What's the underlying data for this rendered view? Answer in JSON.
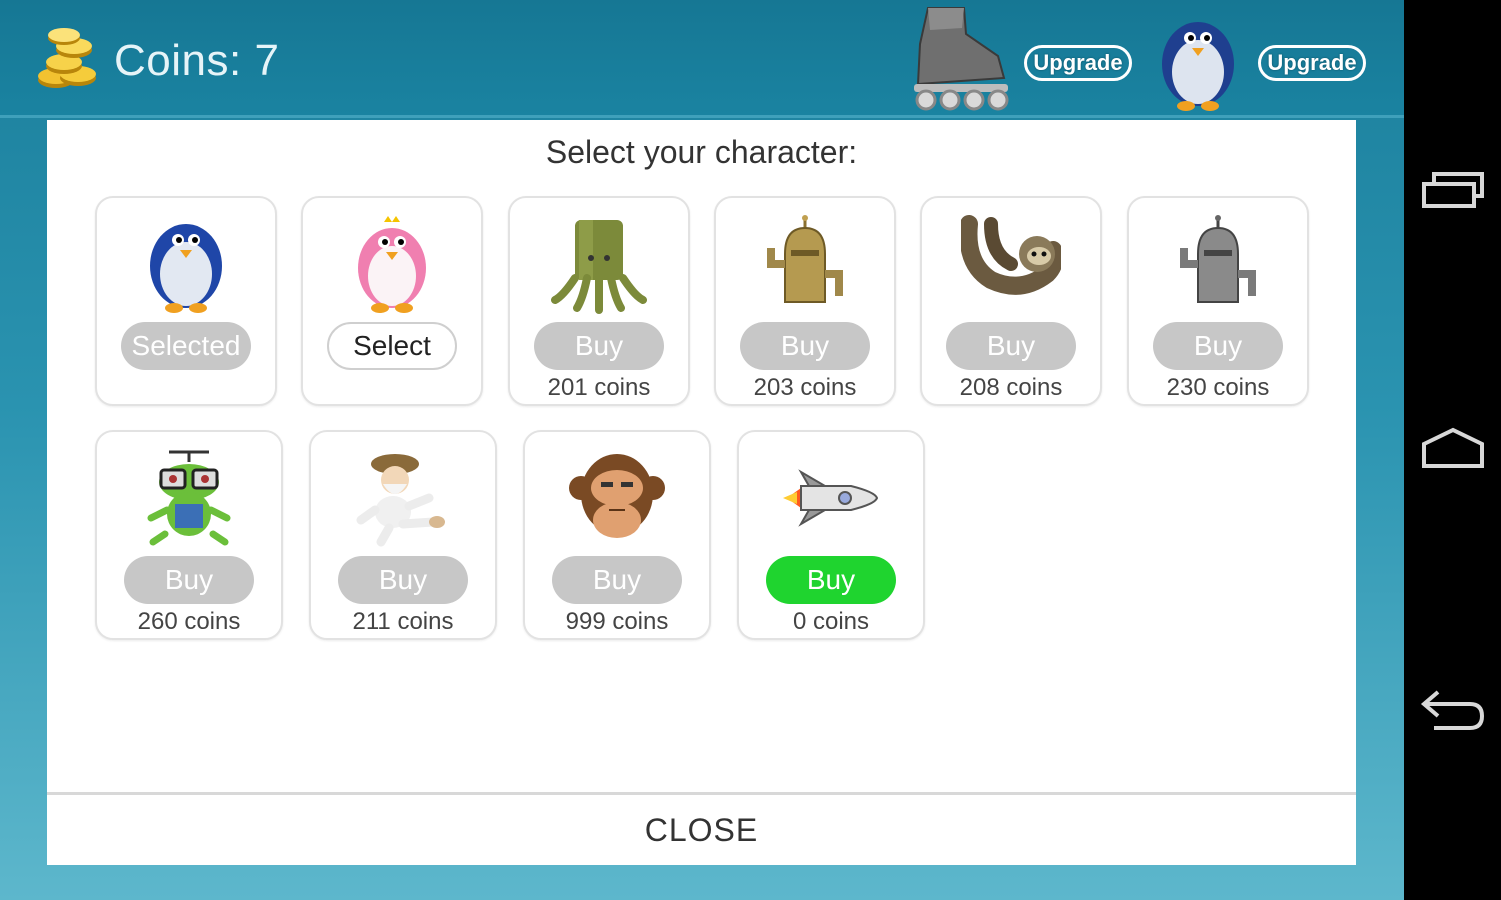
{
  "header": {
    "coins_label": "Coins: 7",
    "upgrade_1": "Upgrade",
    "upgrade_2": "Upgrade"
  },
  "dialog": {
    "title": "Select your character:",
    "close_label": "CLOSE",
    "characters": [
      {
        "icon": "blue-penguin-icon",
        "button": "Selected",
        "price": ""
      },
      {
        "icon": "pink-penguin-icon",
        "button": "Select",
        "price": ""
      },
      {
        "icon": "squid-icon",
        "button": "Buy",
        "price": "201 coins"
      },
      {
        "icon": "golden-robot-icon",
        "button": "Buy",
        "price": "203 coins"
      },
      {
        "icon": "sloth-icon",
        "button": "Buy",
        "price": "208 coins"
      },
      {
        "icon": "metal-robot-icon",
        "button": "Buy",
        "price": "230 coins"
      },
      {
        "icon": "frog-icon",
        "button": "Buy",
        "price": "260 coins"
      },
      {
        "icon": "gnome-icon",
        "button": "Buy",
        "price": "211 coins"
      },
      {
        "icon": "monkey-icon",
        "button": "Buy",
        "price": "999 coins"
      },
      {
        "icon": "rocket-icon",
        "button": "Buy",
        "price": "0 coins"
      }
    ]
  },
  "colors": {
    "topbar": "#1a83a1",
    "buy_disabled": "#c7c7c7",
    "buy_enabled": "#1fd42f"
  }
}
